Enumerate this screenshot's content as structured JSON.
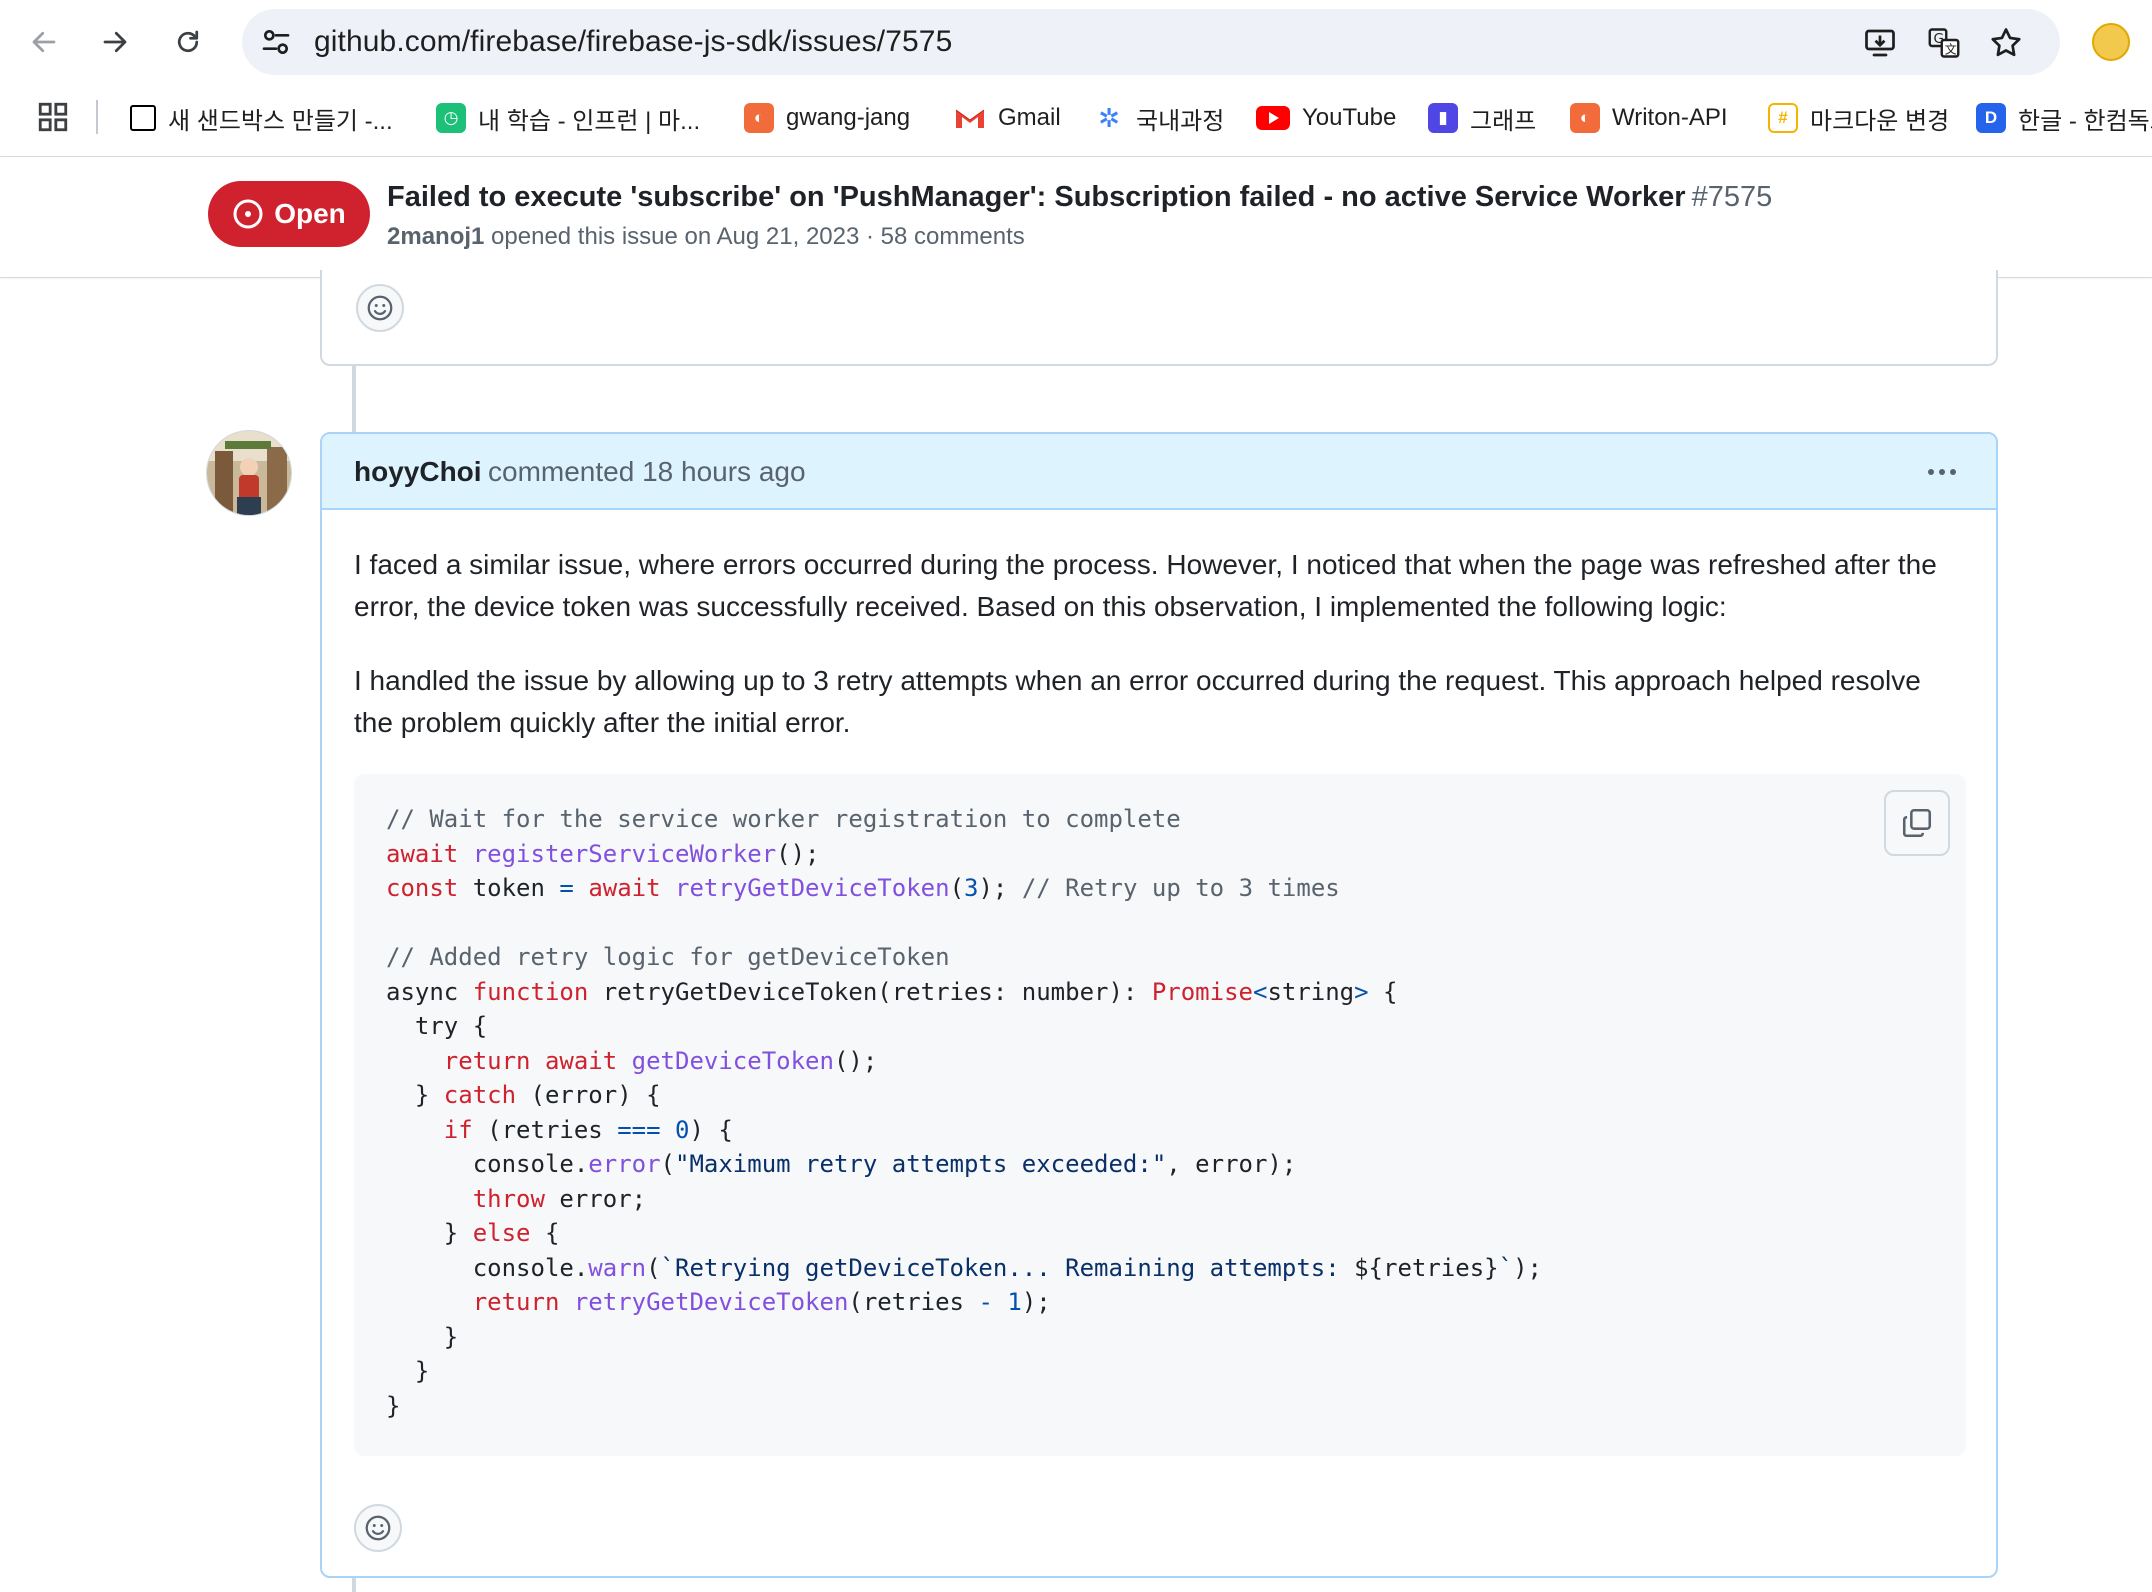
{
  "browser": {
    "url": "github.com/firebase/firebase-js-sdk/issues/7575",
    "bookmarks": [
      {
        "label": "새 샌드박스 만들기 -...",
        "icon": "notion-icon",
        "color": "#000000"
      },
      {
        "label": "내 학습 - 인프런 | 마...",
        "icon": "inflearn-icon",
        "color": "#1dc078"
      },
      {
        "label": "gwang-jang",
        "icon": "bookmark-app-icon",
        "color": "#f26b3a"
      },
      {
        "label": "Gmail",
        "icon": "gmail-icon",
        "color": "#ea4335"
      },
      {
        "label": "국내과정",
        "icon": "pinwheel-icon",
        "color": "#3b82f6"
      },
      {
        "label": "YouTube",
        "icon": "youtube-icon",
        "color": "#ff0000"
      },
      {
        "label": "그래프",
        "icon": "chart-app-icon",
        "color": "#4f46e5"
      },
      {
        "label": "Writon-API",
        "icon": "bookmark-app-icon",
        "color": "#f26b3a"
      },
      {
        "label": "마크다운 변경",
        "icon": "markdown-icon",
        "color": "#f5b400"
      },
      {
        "label": "한글 - 한컴독스",
        "icon": "hancom-docs-icon",
        "color": "#2563eb"
      }
    ]
  },
  "issue": {
    "state": "Open",
    "title": "Failed to execute 'subscribe' on 'PushManager': Subscription failed - no active Service Worker",
    "number": "#7575",
    "author": "2manoj1",
    "meta": "opened this issue on Aug 21, 2023 · 58 comments"
  },
  "comment": {
    "author": "hoyyChoi",
    "when": "commented 18 hours ago",
    "paragraph1": "I faced a similar issue, where errors occurred during the process. However, I noticed that when the page was refreshed after the error, the device token was successfully received. Based on this observation, I implemented the following logic:",
    "paragraph2": "I handled the issue by allowing up to 3 retry attempts when an error occurred during the request. This approach helped resolve the problem quickly after the initial error.",
    "code_lines": [
      [
        [
          "c-com",
          "// Wait for the service worker registration to complete"
        ]
      ],
      [
        [
          "c-kw",
          "await"
        ],
        [
          "",
          " "
        ],
        [
          "c-fn",
          "registerServiceWorker"
        ],
        [
          "",
          "();"
        ]
      ],
      [
        [
          "c-kw",
          "const"
        ],
        [
          "",
          " token "
        ],
        [
          "c-op",
          "="
        ],
        [
          "",
          " "
        ],
        [
          "c-kw",
          "await"
        ],
        [
          "",
          " "
        ],
        [
          "c-fn",
          "retryGetDeviceToken"
        ],
        [
          "",
          "("
        ],
        [
          "c-num",
          "3"
        ],
        [
          "",
          "); "
        ],
        [
          "c-com",
          "// Retry up to 3 times"
        ]
      ],
      [
        [
          "",
          ""
        ]
      ],
      [
        [
          "c-com",
          "// Added retry logic for getDeviceToken"
        ]
      ],
      [
        [
          "",
          "async "
        ],
        [
          "c-kw",
          "function"
        ],
        [
          "",
          " retryGetDeviceToken(retries: number): "
        ],
        [
          "c-kw",
          "Promise"
        ],
        [
          "c-op",
          "<"
        ],
        [
          "",
          "string"
        ],
        [
          "c-op",
          ">"
        ],
        [
          "",
          " {"
        ]
      ],
      [
        [
          "",
          "  try {"
        ]
      ],
      [
        [
          "",
          "    "
        ],
        [
          "c-kw",
          "return"
        ],
        [
          "",
          " "
        ],
        [
          "c-kw",
          "await"
        ],
        [
          "",
          " "
        ],
        [
          "c-fn",
          "getDeviceToken"
        ],
        [
          "",
          "();"
        ]
      ],
      [
        [
          "",
          "  } "
        ],
        [
          "c-kw",
          "catch"
        ],
        [
          "",
          " (error) {"
        ]
      ],
      [
        [
          "",
          "    "
        ],
        [
          "c-kw",
          "if"
        ],
        [
          "",
          " (retries "
        ],
        [
          "c-op",
          "==="
        ],
        [
          "",
          " "
        ],
        [
          "c-num",
          "0"
        ],
        [
          "",
          ") {"
        ]
      ],
      [
        [
          "",
          "      console."
        ],
        [
          "c-fn",
          "error"
        ],
        [
          "",
          "("
        ],
        [
          "c-str",
          "\"Maximum retry attempts exceeded:\""
        ],
        [
          "",
          ", error);"
        ]
      ],
      [
        [
          "",
          "      "
        ],
        [
          "c-kw",
          "throw"
        ],
        [
          "",
          " error;"
        ]
      ],
      [
        [
          "",
          "    } "
        ],
        [
          "c-kw",
          "else"
        ],
        [
          "",
          " {"
        ]
      ],
      [
        [
          "",
          "      console."
        ],
        [
          "c-fn",
          "warn"
        ],
        [
          "",
          "("
        ],
        [
          "c-str",
          "`Retrying getDeviceToken... Remaining attempts: "
        ],
        [
          "",
          "${retries}"
        ],
        [
          "c-str",
          "`"
        ],
        [
          "",
          ");"
        ]
      ],
      [
        [
          "",
          "      "
        ],
        [
          "c-kw",
          "return"
        ],
        [
          "",
          " "
        ],
        [
          "c-fn",
          "retryGetDeviceToken"
        ],
        [
          "",
          "(retries "
        ],
        [
          "c-op",
          "-"
        ],
        [
          "",
          " "
        ],
        [
          "c-num",
          "1"
        ],
        [
          "",
          ");"
        ]
      ],
      [
        [
          "",
          "    }"
        ]
      ],
      [
        [
          "",
          "  }"
        ]
      ],
      [
        [
          "",
          "}"
        ]
      ]
    ]
  }
}
